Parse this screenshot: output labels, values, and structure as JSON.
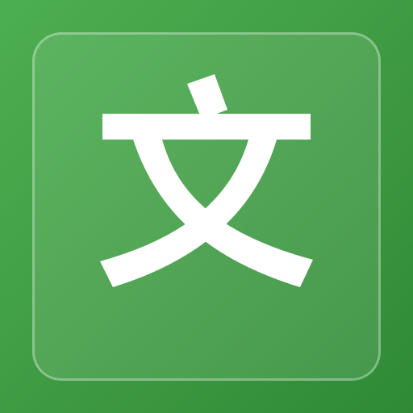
{
  "icon": {
    "name": "translate-icon",
    "glyph_char": "文",
    "colors": {
      "background_start": "#4caf50",
      "background_end": "#2f8a36",
      "tile_border": "rgba(255,255,255,0.32)",
      "glyph": "#ffffff"
    }
  }
}
